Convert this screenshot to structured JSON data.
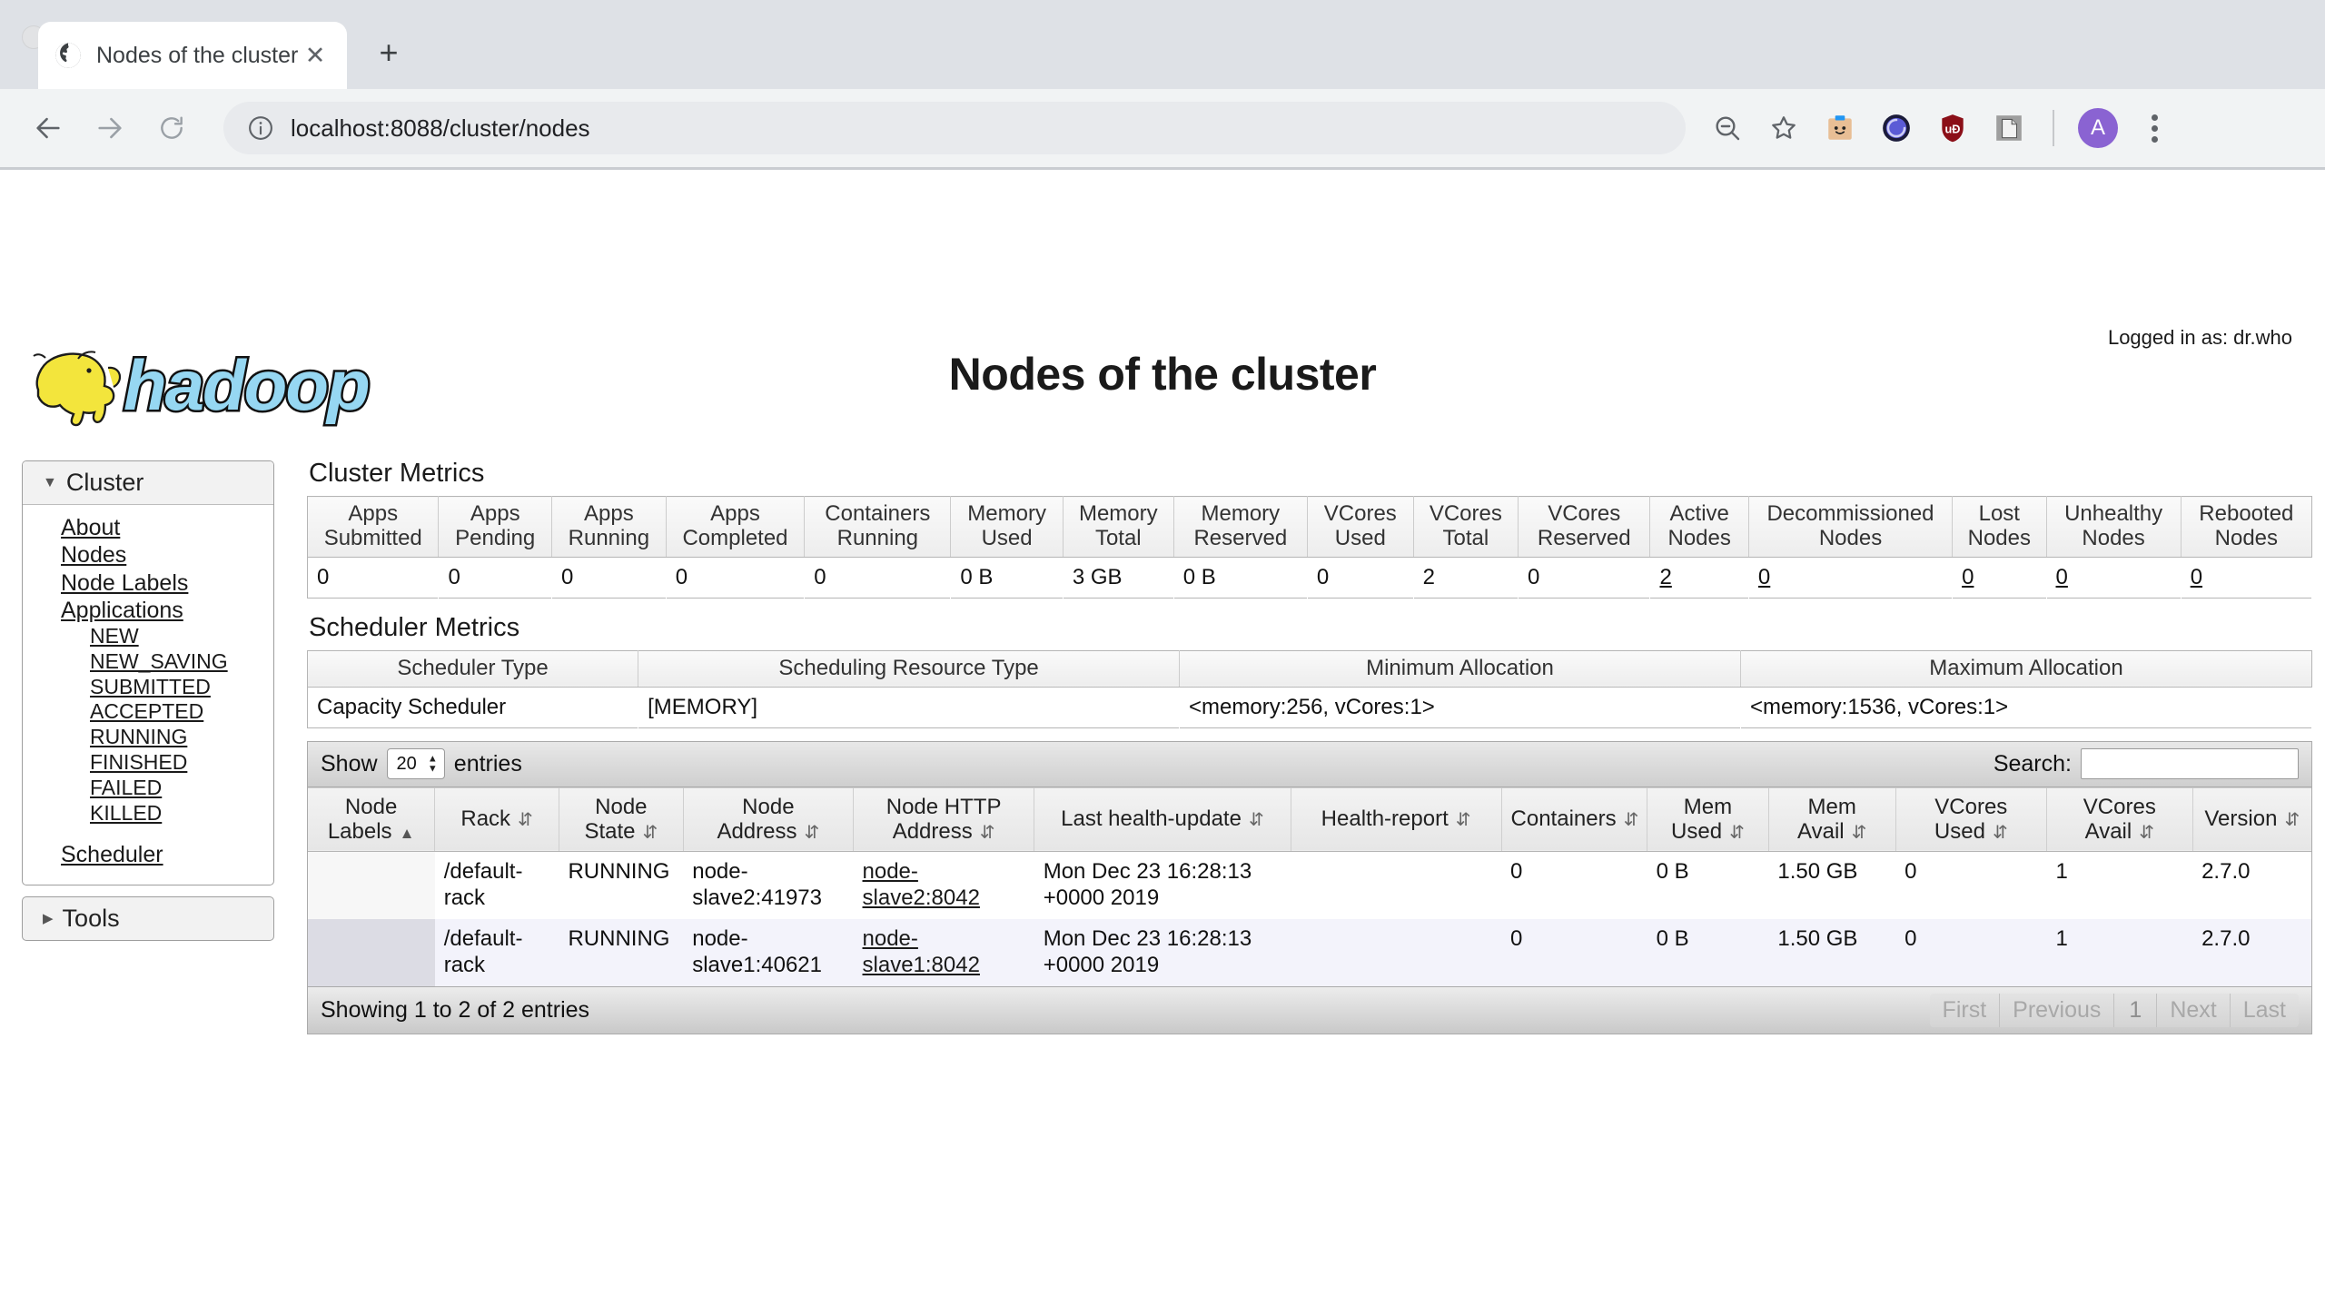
{
  "browser": {
    "tab": {
      "title": "Nodes of the cluster",
      "favicon_icon": "globe-icon",
      "close_icon": "close-icon"
    },
    "new_tab_icon": "plus-icon",
    "back_icon": "back-arrow-icon",
    "forward_icon": "forward-arrow-icon",
    "reload_icon": "reload-icon",
    "site_info_icon": "info-circle-icon",
    "url": "localhost:8088/cluster/nodes",
    "url_host": "localhost:8088",
    "url_path": "/cluster/nodes",
    "toolbar_icons": [
      "zoom-out-icon",
      "bookmark-star-icon",
      "extension-bitwarden-icon",
      "extension-grammarly-icon",
      "extension-ublock-origin-icon",
      "extension-clipboard-icon"
    ],
    "profile_initial": "A",
    "menu_icon": "kebab-menu-icon"
  },
  "header": {
    "logged_in_label": "Logged in as: dr.who",
    "logo_alt": "hadoop-logo",
    "logo_text": "hadoop",
    "page_title": "Nodes of the cluster"
  },
  "sidebar": {
    "cluster": {
      "label": "Cluster",
      "caret_icon": "caret-down-icon",
      "links": [
        "About",
        "Nodes",
        "Node Labels",
        "Applications"
      ],
      "app_states": [
        "NEW",
        "NEW_SAVING",
        "SUBMITTED",
        "ACCEPTED",
        "RUNNING",
        "FINISHED",
        "FAILED",
        "KILLED"
      ],
      "scheduler_link": "Scheduler"
    },
    "tools": {
      "label": "Tools",
      "caret_icon": "caret-right-icon"
    }
  },
  "cluster_metrics": {
    "title": "Cluster Metrics",
    "headers": [
      "Apps Submitted",
      "Apps Pending",
      "Apps Running",
      "Apps Completed",
      "Containers Running",
      "Memory Used",
      "Memory Total",
      "Memory Reserved",
      "VCores Used",
      "VCores Total",
      "VCores Reserved",
      "Active Nodes",
      "Decommissioned Nodes",
      "Lost Nodes",
      "Unhealthy Nodes",
      "Rebooted Nodes"
    ],
    "values": [
      "0",
      "0",
      "0",
      "0",
      "0",
      "0 B",
      "3 GB",
      "0 B",
      "0",
      "2",
      "0",
      "2",
      "0",
      "0",
      "0",
      "0"
    ],
    "link_flags": [
      false,
      false,
      false,
      false,
      false,
      false,
      false,
      false,
      false,
      false,
      false,
      true,
      true,
      true,
      true,
      true
    ]
  },
  "scheduler_metrics": {
    "title": "Scheduler Metrics",
    "headers": [
      "Scheduler Type",
      "Scheduling Resource Type",
      "Minimum Allocation",
      "Maximum Allocation"
    ],
    "values": [
      "Capacity Scheduler",
      "[MEMORY]",
      "<memory:256, vCores:1>",
      "<memory:1536, vCores:1>"
    ]
  },
  "nodes_table": {
    "show_label": "Show",
    "entries_label": "entries",
    "page_length": "20",
    "search_label": "Search:",
    "search_value": "",
    "search_placeholder": "",
    "headers": [
      "Node Labels",
      "Rack",
      "Node State",
      "Node Address",
      "Node HTTP Address",
      "Last health-update",
      "Health-report",
      "Containers",
      "Mem Used",
      "Mem Avail",
      "VCores Used",
      "VCores Avail",
      "Version"
    ],
    "sorted_column": "Node Labels",
    "sort_direction_icon": "sort-asc-icon",
    "sort_icon": "sort-both-icon",
    "rows": [
      {
        "node_labels": "",
        "rack": "/default-rack",
        "node_state": "RUNNING",
        "node_address": "node-slave2:41973",
        "node_http_address": "node-slave2:8042",
        "last_health_update": "Mon Dec 23 16:28:13 +0000 2019",
        "health_report": "",
        "containers": "0",
        "mem_used": "0 B",
        "mem_avail": "1.50 GB",
        "vcores_used": "0",
        "vcores_avail": "1",
        "version": "2.7.0"
      },
      {
        "node_labels": "",
        "rack": "/default-rack",
        "node_state": "RUNNING",
        "node_address": "node-slave1:40621",
        "node_http_address": "node-slave1:8042",
        "last_health_update": "Mon Dec 23 16:28:13 +0000 2019",
        "health_report": "",
        "containers": "0",
        "mem_used": "0 B",
        "mem_avail": "1.50 GB",
        "vcores_used": "0",
        "vcores_avail": "1",
        "version": "2.7.0"
      }
    ],
    "info": "Showing 1 to 2 of 2 entries",
    "paginate": [
      "First",
      "Previous",
      "1",
      "Next",
      "Last"
    ]
  },
  "colors": {
    "logo_yellow": "#f2e43a",
    "logo_blue": "#96d7f2",
    "accent_link": "#1a1a1a",
    "row_alt": "#f3f3fb",
    "sort_col_alt": "#dcdce4"
  }
}
